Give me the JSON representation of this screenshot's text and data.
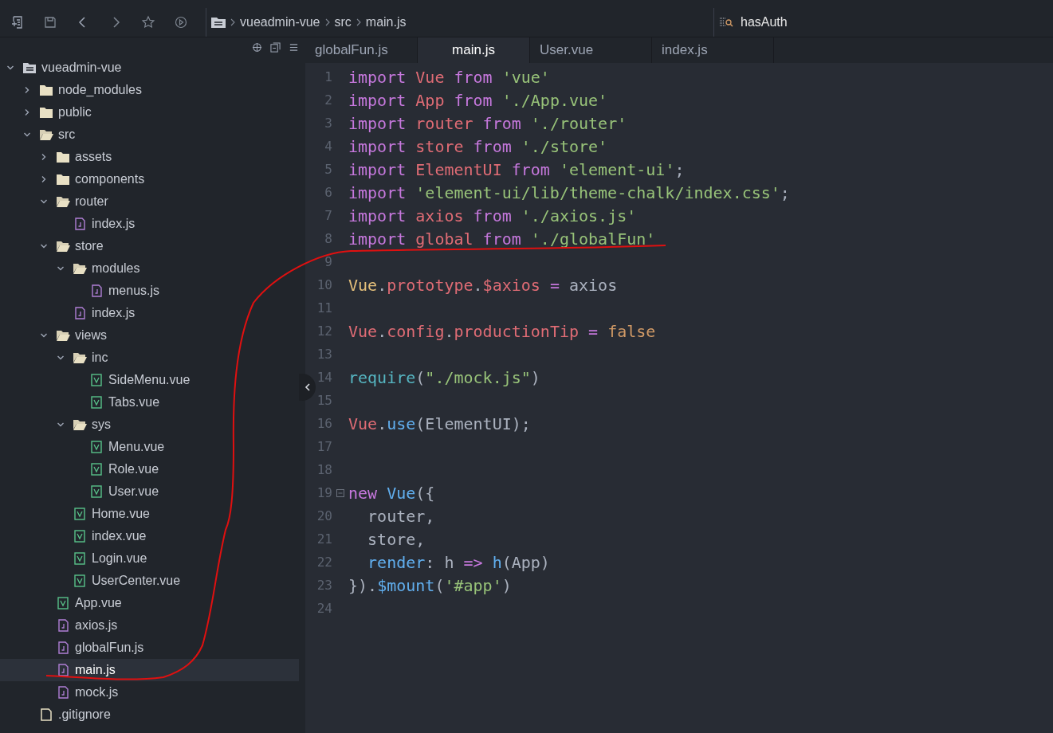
{
  "breadcrumb": [
    "vueadmin-vue",
    "src",
    "main.js"
  ],
  "symbol_search": {
    "value": "hasAuth"
  },
  "tree": [
    {
      "name": "vueadmin-vue",
      "kind": "root",
      "expanded": true,
      "selected": false,
      "children": [
        {
          "name": "node_modules",
          "kind": "folder",
          "expanded": false,
          "selected": false
        },
        {
          "name": "public",
          "kind": "folder",
          "expanded": false,
          "selected": false
        },
        {
          "name": "src",
          "kind": "folder",
          "expanded": true,
          "selected": false,
          "children": [
            {
              "name": "assets",
              "kind": "folder",
              "expanded": false,
              "selected": false
            },
            {
              "name": "components",
              "kind": "folder",
              "expanded": false,
              "selected": false
            },
            {
              "name": "router",
              "kind": "folder",
              "expanded": true,
              "selected": false,
              "children": [
                {
                  "name": "index.js",
                  "kind": "js",
                  "selected": false
                }
              ]
            },
            {
              "name": "store",
              "kind": "folder",
              "expanded": true,
              "selected": false,
              "children": [
                {
                  "name": "modules",
                  "kind": "folder",
                  "expanded": true,
                  "selected": false,
                  "children": [
                    {
                      "name": "menus.js",
                      "kind": "js",
                      "selected": false
                    }
                  ]
                },
                {
                  "name": "index.js",
                  "kind": "js",
                  "selected": false
                }
              ]
            },
            {
              "name": "views",
              "kind": "folder",
              "expanded": true,
              "selected": false,
              "children": [
                {
                  "name": "inc",
                  "kind": "folder",
                  "expanded": true,
                  "selected": false,
                  "children": [
                    {
                      "name": "SideMenu.vue",
                      "kind": "vue",
                      "selected": false
                    },
                    {
                      "name": "Tabs.vue",
                      "kind": "vue",
                      "selected": false
                    }
                  ]
                },
                {
                  "name": "sys",
                  "kind": "folder",
                  "expanded": true,
                  "selected": false,
                  "children": [
                    {
                      "name": "Menu.vue",
                      "kind": "vue",
                      "selected": false
                    },
                    {
                      "name": "Role.vue",
                      "kind": "vue",
                      "selected": false
                    },
                    {
                      "name": "User.vue",
                      "kind": "vue",
                      "selected": false
                    }
                  ]
                },
                {
                  "name": "Home.vue",
                  "kind": "vue",
                  "selected": false
                },
                {
                  "name": "index.vue",
                  "kind": "vue",
                  "selected": false
                },
                {
                  "name": "Login.vue",
                  "kind": "vue",
                  "selected": false
                },
                {
                  "name": "UserCenter.vue",
                  "kind": "vue",
                  "selected": false
                }
              ]
            },
            {
              "name": "App.vue",
              "kind": "vue",
              "selected": false
            },
            {
              "name": "axios.js",
              "kind": "js",
              "selected": false
            },
            {
              "name": "globalFun.js",
              "kind": "js",
              "selected": false
            },
            {
              "name": "main.js",
              "kind": "js",
              "selected": true
            },
            {
              "name": "mock.js",
              "kind": "js",
              "selected": false
            }
          ]
        },
        {
          "name": ".gitignore",
          "kind": "file",
          "selected": false
        }
      ]
    }
  ],
  "tabs": [
    {
      "label": "globalFun.js",
      "selected": false
    },
    {
      "label": "main.js",
      "selected": true
    },
    {
      "label": "User.vue",
      "selected": false
    },
    {
      "label": "index.js",
      "selected": false
    }
  ],
  "code": [
    {
      "number": "1",
      "tokens": [
        {
          "text": "import ",
          "kind": "kw"
        },
        {
          "text": "Vue ",
          "kind": "var"
        },
        {
          "text": "from ",
          "kind": "kw"
        },
        {
          "text": "'vue'",
          "kind": "str"
        }
      ]
    },
    {
      "number": "2",
      "tokens": [
        {
          "text": "import ",
          "kind": "kw"
        },
        {
          "text": "App ",
          "kind": "var"
        },
        {
          "text": "from ",
          "kind": "kw"
        },
        {
          "text": "'./App.vue'",
          "kind": "str"
        }
      ]
    },
    {
      "number": "3",
      "tokens": [
        {
          "text": "import ",
          "kind": "kw"
        },
        {
          "text": "router ",
          "kind": "var"
        },
        {
          "text": "from ",
          "kind": "kw"
        },
        {
          "text": "'./router'",
          "kind": "str"
        }
      ]
    },
    {
      "number": "4",
      "tokens": [
        {
          "text": "import ",
          "kind": "kw"
        },
        {
          "text": "store ",
          "kind": "var"
        },
        {
          "text": "from ",
          "kind": "kw"
        },
        {
          "text": "'./store'",
          "kind": "str"
        }
      ]
    },
    {
      "number": "5",
      "tokens": [
        {
          "text": "import ",
          "kind": "kw"
        },
        {
          "text": "ElementUI ",
          "kind": "var"
        },
        {
          "text": "from ",
          "kind": "kw"
        },
        {
          "text": "'element-ui'",
          "kind": "str"
        },
        {
          "text": ";",
          "kind": "plain"
        }
      ]
    },
    {
      "number": "6",
      "tokens": [
        {
          "text": "import ",
          "kind": "kw"
        },
        {
          "text": "'element-ui/lib/theme-chalk/index.css'",
          "kind": "str"
        },
        {
          "text": ";",
          "kind": "plain"
        }
      ]
    },
    {
      "number": "7",
      "tokens": [
        {
          "text": "import ",
          "kind": "kw"
        },
        {
          "text": "axios ",
          "kind": "var"
        },
        {
          "text": "from ",
          "kind": "kw"
        },
        {
          "text": "'./axios.js'",
          "kind": "str"
        }
      ]
    },
    {
      "number": "8",
      "tokens": [
        {
          "text": "import ",
          "kind": "kw"
        },
        {
          "text": "global ",
          "kind": "var"
        },
        {
          "text": "from ",
          "kind": "kw"
        },
        {
          "text": "'./globalFun'",
          "kind": "str"
        }
      ]
    },
    {
      "number": "9"
    },
    {
      "number": "10",
      "tokens": [
        {
          "text": "Vue",
          "kind": "cls"
        },
        {
          "text": ".",
          "kind": "plain"
        },
        {
          "text": "prototype",
          "kind": "var"
        },
        {
          "text": ".",
          "kind": "plain"
        },
        {
          "text": "$axios ",
          "kind": "var"
        },
        {
          "text": "= ",
          "kind": "kw"
        },
        {
          "text": "axios",
          "kind": "plain"
        }
      ]
    },
    {
      "number": "11"
    },
    {
      "number": "12",
      "tokens": [
        {
          "text": "Vue",
          "kind": "var"
        },
        {
          "text": ".",
          "kind": "plain"
        },
        {
          "text": "config",
          "kind": "var"
        },
        {
          "text": ".",
          "kind": "plain"
        },
        {
          "text": "productionTip ",
          "kind": "var"
        },
        {
          "text": "= ",
          "kind": "kw"
        },
        {
          "text": "false",
          "kind": "bool"
        }
      ]
    },
    {
      "number": "13"
    },
    {
      "number": "14",
      "tokens": [
        {
          "text": "require",
          "kind": "fn"
        },
        {
          "text": "(",
          "kind": "plain"
        },
        {
          "text": "\"./mock.js\"",
          "kind": "str"
        },
        {
          "text": ")",
          "kind": "plain"
        }
      ]
    },
    {
      "number": "15"
    },
    {
      "number": "16",
      "tokens": [
        {
          "text": "Vue",
          "kind": "var"
        },
        {
          "text": ".",
          "kind": "plain"
        },
        {
          "text": "use",
          "kind": "method"
        },
        {
          "text": "(ElementUI);",
          "kind": "plain"
        }
      ]
    },
    {
      "number": "17"
    },
    {
      "number": "18"
    },
    {
      "number": "19",
      "foldable": true,
      "tokens": [
        {
          "text": "new ",
          "kind": "kw"
        },
        {
          "text": "Vue",
          "kind": "method"
        },
        {
          "text": "({",
          "kind": "plain"
        }
      ]
    },
    {
      "number": "20",
      "tokens": [
        {
          "text": "  router,",
          "kind": "plain"
        }
      ]
    },
    {
      "number": "21",
      "tokens": [
        {
          "text": "  store,",
          "kind": "plain"
        }
      ]
    },
    {
      "number": "22",
      "tokens": [
        {
          "text": "  render",
          "kind": "method"
        },
        {
          "text": ": h ",
          "kind": "plain"
        },
        {
          "text": "=> ",
          "kind": "kw"
        },
        {
          "text": "h",
          "kind": "method"
        },
        {
          "text": "(App)",
          "kind": "plain"
        }
      ]
    },
    {
      "number": "23",
      "tokens": [
        {
          "text": "}).",
          "kind": "plain"
        },
        {
          "text": "$mount",
          "kind": "method"
        },
        {
          "text": "(",
          "kind": "plain"
        },
        {
          "text": "'#app'",
          "kind": "str"
        },
        {
          "text": ")",
          "kind": "plain"
        }
      ]
    },
    {
      "number": "24"
    }
  ]
}
